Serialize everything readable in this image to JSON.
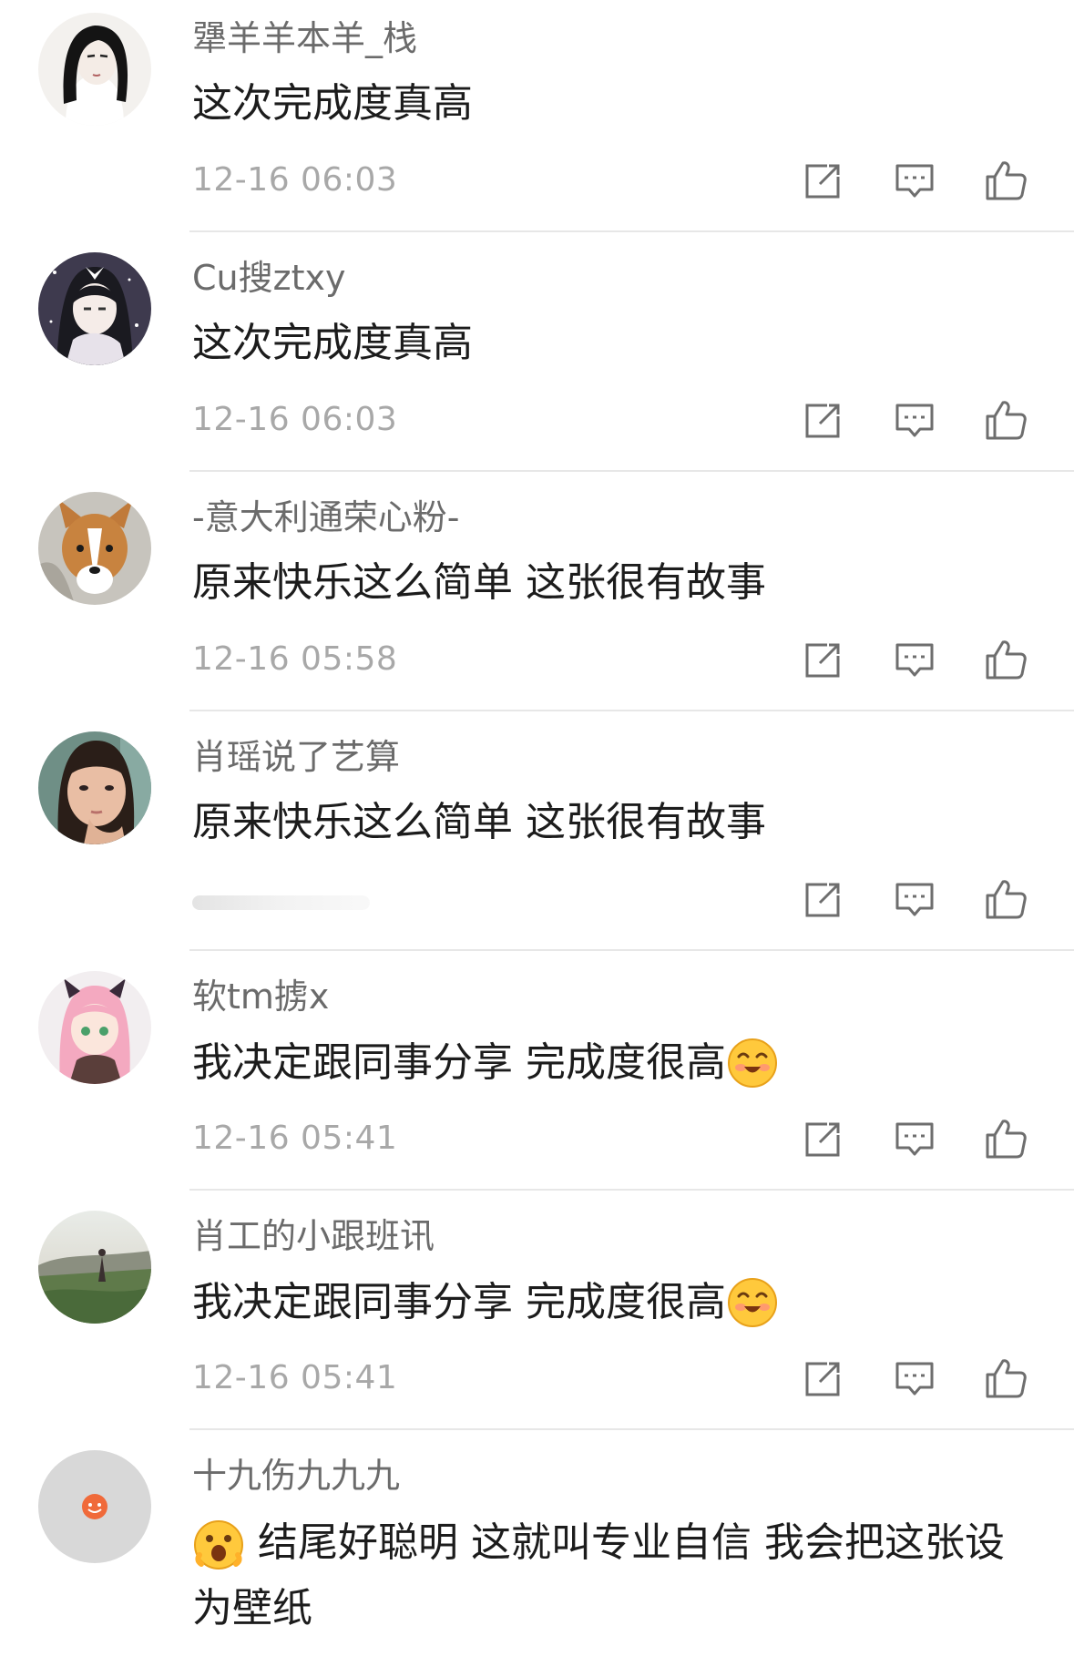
{
  "comments": [
    {
      "user": "犟羊羊本羊_栈",
      "text": "这次完成度真高",
      "time": "12-16 06:03"
    },
    {
      "user": "Cu搜ztxy",
      "text": "这次完成度真高",
      "time": "12-16 06:03"
    },
    {
      "user": "-意大利通荣心粉-",
      "text": "原来快乐这么简单 这张很有故事",
      "time": "12-16 05:58"
    },
    {
      "user": "肖瑶说了艺算",
      "text": "原来快乐这么简单 这张很有故事",
      "time": ""
    },
    {
      "user": "软tm掳x",
      "text": "我决定跟同事分享 完成度很高",
      "time": "12-16 05:41"
    },
    {
      "user": "肖工的小跟班讯",
      "text": "我决定跟同事分享 完成度很高",
      "time": "12-16 05:41"
    },
    {
      "user": "十九伤九九九",
      "text": "结尾好聪明 这就叫专业自信 我会把这张设为壁纸",
      "time": ""
    }
  ],
  "icons": {
    "share": "share-icon",
    "reply": "reply-icon",
    "like": "like-icon"
  },
  "colors": {
    "username": "#6b6b6b",
    "text": "#1c1c1c",
    "time": "#a8a8a8",
    "icon": "#6e6e6e",
    "divider": "#e7e7e7",
    "default_avatar_bg": "#d8d8d8",
    "default_avatar_logo": "#f06a3a"
  }
}
